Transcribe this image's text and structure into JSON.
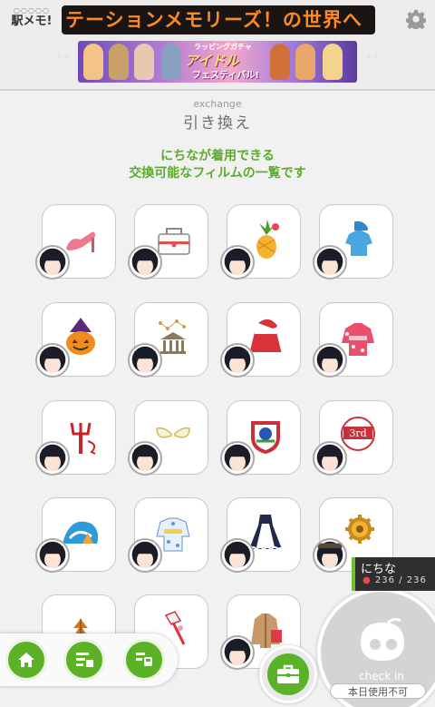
{
  "header": {
    "logo_dots": "○○○○○",
    "logo_name": "駅メモ!",
    "marquee_text": "テーションメモリーズ！の世界へ",
    "banner": {
      "line1": "ラッピングガチャ",
      "line2": "アイドル",
      "line3": "フェスティバル!"
    }
  },
  "page": {
    "subtitle": "exchange",
    "title": "引き換え",
    "description_line1": "にちなが着用できる",
    "description_line2": "交換可能なフィルムの一覧です"
  },
  "items": [
    {
      "icon": "high-heel-icon"
    },
    {
      "icon": "toolbox-icon"
    },
    {
      "icon": "pineapple-icon"
    },
    {
      "icon": "pajamas-icon"
    },
    {
      "icon": "pumpkin-icon"
    },
    {
      "icon": "constellation-icon"
    },
    {
      "icon": "santa-cape-icon"
    },
    {
      "icon": "kimono-icon"
    },
    {
      "icon": "devil-trident-icon"
    },
    {
      "icon": "angel-wings-icon"
    },
    {
      "icon": "emblem-icon"
    },
    {
      "icon": "3rd-badge-icon",
      "label": "3rd"
    },
    {
      "icon": "tent-icon"
    },
    {
      "icon": "yukata-icon"
    },
    {
      "icon": "maid-dress-icon"
    },
    {
      "icon": "gear-wheel-icon"
    },
    {
      "icon": "autumn-leaves-icon"
    },
    {
      "icon": "gift-scroll-icon"
    },
    {
      "icon": "coat-icon"
    }
  ],
  "status": {
    "name": "にちな",
    "power": "236 / 236"
  },
  "checkin": {
    "label": "check in",
    "button": "本日使用不可"
  },
  "colors": {
    "accent": "#5bb229",
    "description": "#5cab2b",
    "marquee_text": "#ff8a22"
  }
}
